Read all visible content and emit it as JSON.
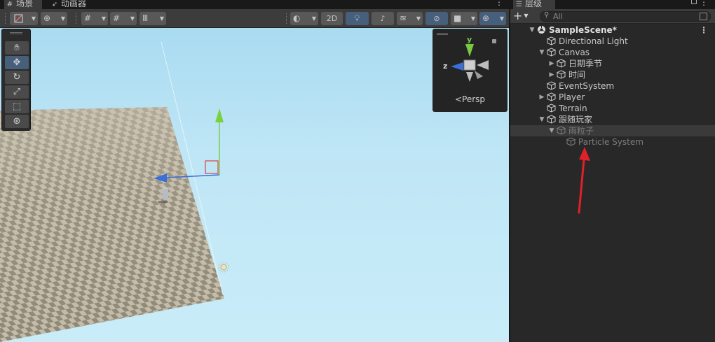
{
  "scene_panel": {
    "tabs": [
      {
        "label": "场景",
        "icon": "hash-icon"
      },
      {
        "label": "动画器",
        "icon": "animator-icon"
      }
    ],
    "toolbar": {
      "toggle_2d_label": "2D",
      "buttons": [
        "shading-mode",
        "draw-mode",
        "grid-snap",
        "snap-increment",
        "ruler",
        "lighting",
        "audio",
        "effects",
        "visibility",
        "camera",
        "gizmos"
      ]
    },
    "tools": [
      "hand-tool",
      "move-tool",
      "rotate-tool",
      "scale-tool",
      "rect-tool",
      "transform-tool"
    ],
    "active_tool": "move-tool",
    "gizmo": {
      "y_label": "y",
      "z_label": "z",
      "projection_label": "<Persp"
    }
  },
  "hierarchy": {
    "tab_label": "层级",
    "add_label": "+",
    "search": {
      "placeholder": "All",
      "value": ""
    },
    "items": [
      {
        "label": "SampleScene*",
        "depth": 0,
        "expanded": true,
        "type": "scene"
      },
      {
        "label": "Directional Light",
        "depth": 1,
        "expanded": null,
        "type": "object"
      },
      {
        "label": "Canvas",
        "depth": 1,
        "expanded": true,
        "type": "object"
      },
      {
        "label": "日期季节",
        "depth": 2,
        "expanded": false,
        "type": "object"
      },
      {
        "label": "时间",
        "depth": 2,
        "expanded": false,
        "type": "object"
      },
      {
        "label": "EventSystem",
        "depth": 1,
        "expanded": null,
        "type": "object"
      },
      {
        "label": "Player",
        "depth": 1,
        "expanded": false,
        "type": "object"
      },
      {
        "label": "Terrain",
        "depth": 1,
        "expanded": null,
        "type": "object"
      },
      {
        "label": "跟随玩家",
        "depth": 1,
        "expanded": true,
        "type": "object"
      },
      {
        "label": "雨粒子",
        "depth": 2,
        "expanded": true,
        "type": "object",
        "selected": true,
        "disabled": true
      },
      {
        "label": "Particle System",
        "depth": 3,
        "expanded": null,
        "type": "object",
        "disabled": true
      }
    ]
  },
  "colors": {
    "active_blue": "#46607c",
    "annotation_red": "#e0202a",
    "gizmo_y": "#7ac943",
    "gizmo_z": "#3a6fd8"
  }
}
